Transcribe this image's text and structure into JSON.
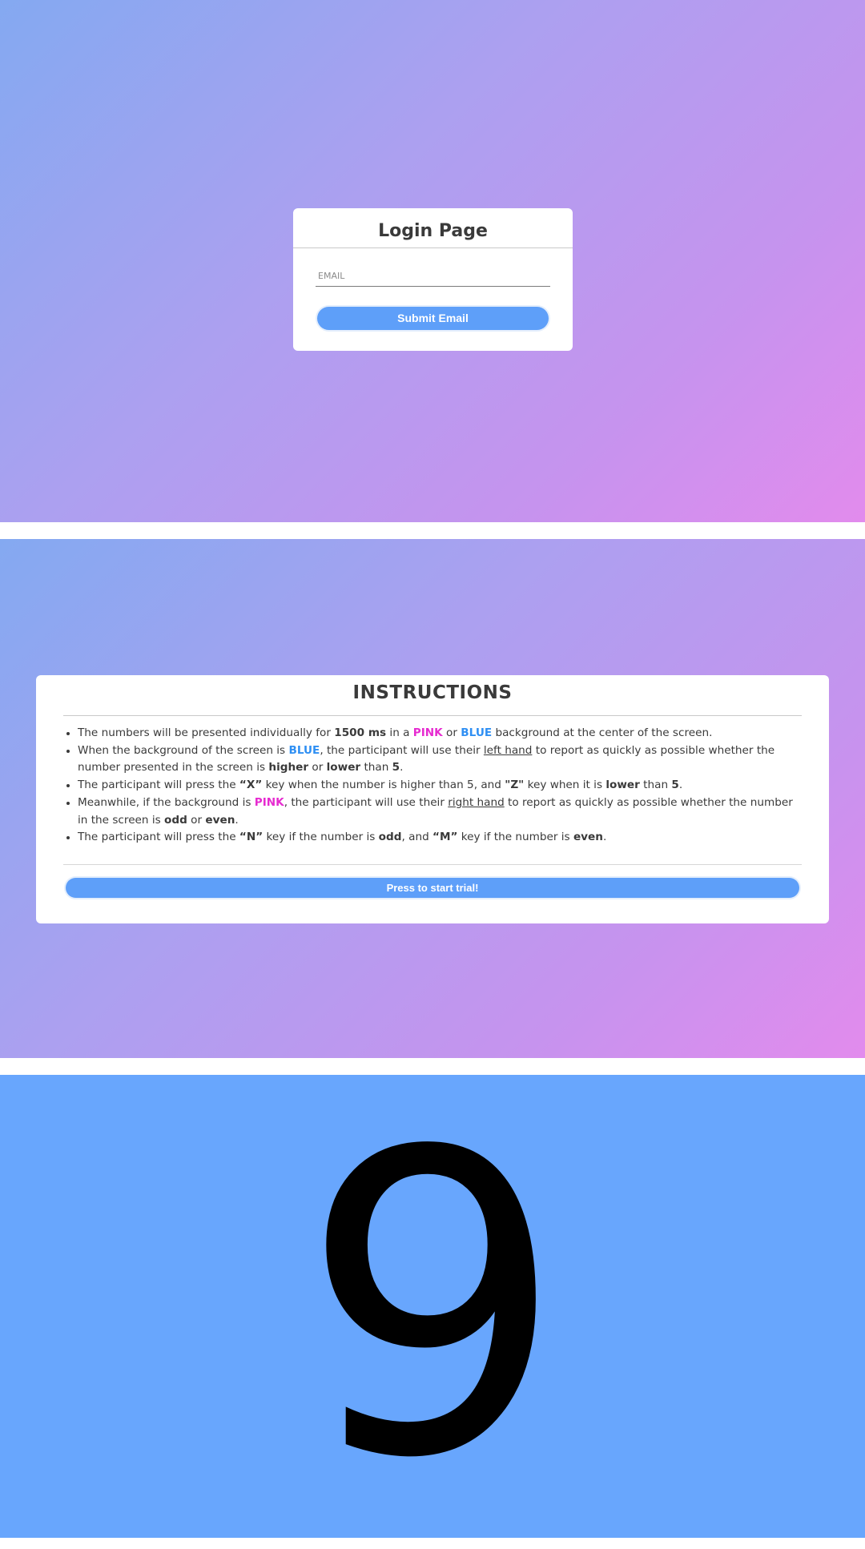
{
  "login": {
    "title": "Login Page",
    "email_placeholder": "EMAIL",
    "email_value": "",
    "submit_label": "Submit Email"
  },
  "instructions": {
    "title": "INSTRUCTIONS",
    "items": [
      [
        {
          "t": "The numbers will be presented individually for "
        },
        {
          "t": "1500 ms",
          "s": "b"
        },
        {
          "t": " in a "
        },
        {
          "t": "PINK",
          "s": "pink"
        },
        {
          "t": " or "
        },
        {
          "t": "BLUE",
          "s": "blue"
        },
        {
          "t": " background at the center of the screen."
        }
      ],
      [
        {
          "t": "When the background of the screen is "
        },
        {
          "t": "BLUE",
          "s": "blue"
        },
        {
          "t": ", the participant will use their "
        },
        {
          "t": "left hand",
          "s": "u"
        },
        {
          "t": " to report as quickly as possible whether the number presented in the screen is "
        },
        {
          "t": "higher",
          "s": "b"
        },
        {
          "t": " or "
        },
        {
          "t": "lower",
          "s": "b"
        },
        {
          "t": " than "
        },
        {
          "t": "5",
          "s": "b"
        },
        {
          "t": "."
        }
      ],
      [
        {
          "t": "The participant will press the "
        },
        {
          "t": "“X”",
          "s": "b"
        },
        {
          "t": " key when the number is higher than 5, and "
        },
        {
          "t": "\"Z\"",
          "s": "b"
        },
        {
          "t": " key when it is "
        },
        {
          "t": "lower",
          "s": "b"
        },
        {
          "t": " than "
        },
        {
          "t": "5",
          "s": "b"
        },
        {
          "t": "."
        }
      ],
      [
        {
          "t": "Meanwhile, if the background is "
        },
        {
          "t": "PINK",
          "s": "pink"
        },
        {
          "t": ", the participant will use their "
        },
        {
          "t": "right hand",
          "s": "u"
        },
        {
          "t": " to report as quickly as possible whether the number in the screen is "
        },
        {
          "t": "odd",
          "s": "b"
        },
        {
          "t": " or "
        },
        {
          "t": "even",
          "s": "b"
        },
        {
          "t": "."
        }
      ],
      [
        {
          "t": "The participant will press the "
        },
        {
          "t": "“N”",
          "s": "b"
        },
        {
          "t": " key if the number is "
        },
        {
          "t": "odd",
          "s": "b"
        },
        {
          "t": ", and "
        },
        {
          "t": "“M”",
          "s": "b"
        },
        {
          "t": " key if the number is "
        },
        {
          "t": "even",
          "s": "b"
        },
        {
          "t": "."
        }
      ]
    ],
    "start_label": "Press to start trial!"
  },
  "stimulus": {
    "number": "9",
    "background_color": "#68a6fd"
  },
  "colors": {
    "pink": "#e62bd0",
    "blue": "#2f8ff3",
    "button": "#5e9ff9",
    "gradient_start": "#84a9f1",
    "gradient_end": "#e28bed"
  }
}
